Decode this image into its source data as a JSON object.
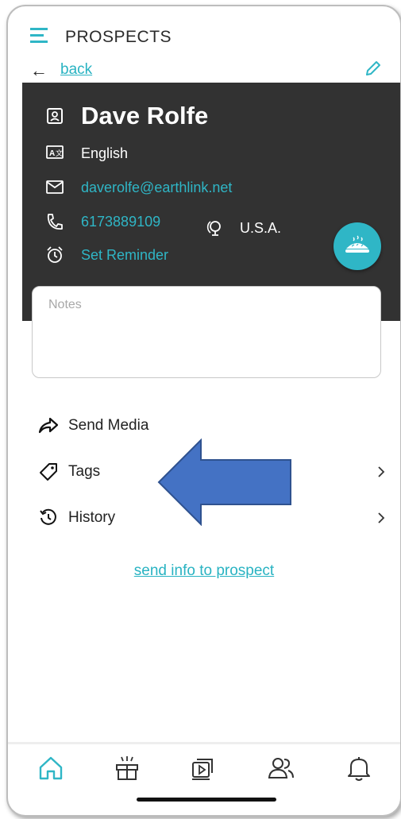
{
  "header": {
    "title": "PROSPECTS",
    "back_label": "back",
    "menu_icon": "hamburger-menu-icon",
    "edit_icon": "pencil-icon"
  },
  "contact": {
    "name": "Dave Rolfe",
    "language": "English",
    "country": "U.S.A.",
    "email": "daverolfe@earthlink.net",
    "phone": "6173889109",
    "reminder_label": "Set Reminder",
    "fab_icon": "pie-icon"
  },
  "notes": {
    "placeholder": "Notes",
    "value": ""
  },
  "actions": {
    "send_media": "Send Media",
    "tags": "Tags",
    "history": "History"
  },
  "send_info_link": "send info to prospect",
  "bottom_nav": [
    "home-icon",
    "gift-icon",
    "media-icon",
    "users-icon",
    "bell-icon"
  ],
  "colors": {
    "accent": "#2fb6c6",
    "card_background": "#323232",
    "overlay_arrow": "#4472c4"
  }
}
